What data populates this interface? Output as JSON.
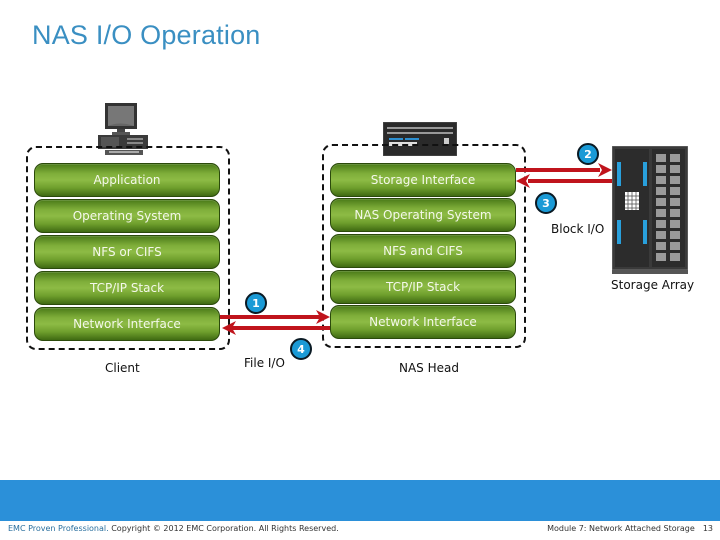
{
  "title": "NAS I/O Operation",
  "client": {
    "label": "Client",
    "icon": "desktop-computer-icon",
    "layers": [
      "Application",
      "Operating System",
      "NFS or CIFS",
      "TCP/IP Stack",
      "Network Interface"
    ]
  },
  "nas_head": {
    "label": "NAS Head",
    "icon": "nas-head-device-icon",
    "layers": [
      "Storage Interface",
      "NAS Operating System",
      "NFS and CIFS",
      "TCP/IP Stack",
      "Network Interface"
    ]
  },
  "storage_array": {
    "label": "Storage Array",
    "icon": "storage-array-rack-icon"
  },
  "connections": {
    "file_io_label": "File I/O",
    "block_io_label": "Block I/O"
  },
  "steps": [
    "1",
    "2",
    "3",
    "4"
  ],
  "colors": {
    "title": "#3a8fc2",
    "layer_green": "#7fae3a",
    "arrow_red": "#c0141c",
    "badge_blue": "#1a9ad6",
    "footer_bar": "#2b90d9"
  },
  "footer": {
    "brand": "EMC Proven Professional.",
    "copyright": " Copyright © 2012 EMC Corporation. All Rights Reserved.",
    "module": "Module 7: Network Attached Storage",
    "page": "13"
  }
}
